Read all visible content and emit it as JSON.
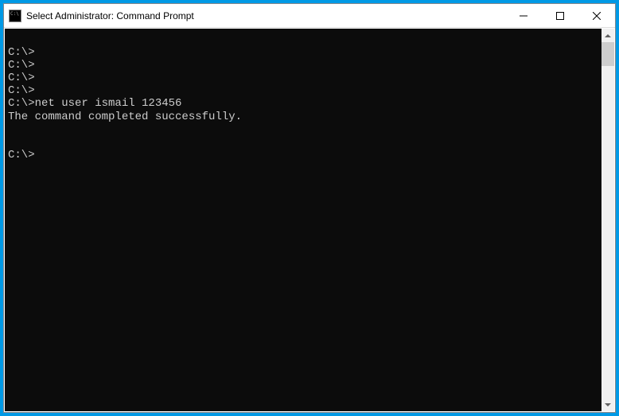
{
  "window": {
    "title": "Select Administrator: Command Prompt"
  },
  "terminal": {
    "lines": [
      "",
      "C:\\>",
      "C:\\>",
      "C:\\>",
      "C:\\>",
      "C:\\>net user ismail 123456",
      "The command completed successfully.",
      "",
      "",
      "C:\\>"
    ]
  }
}
